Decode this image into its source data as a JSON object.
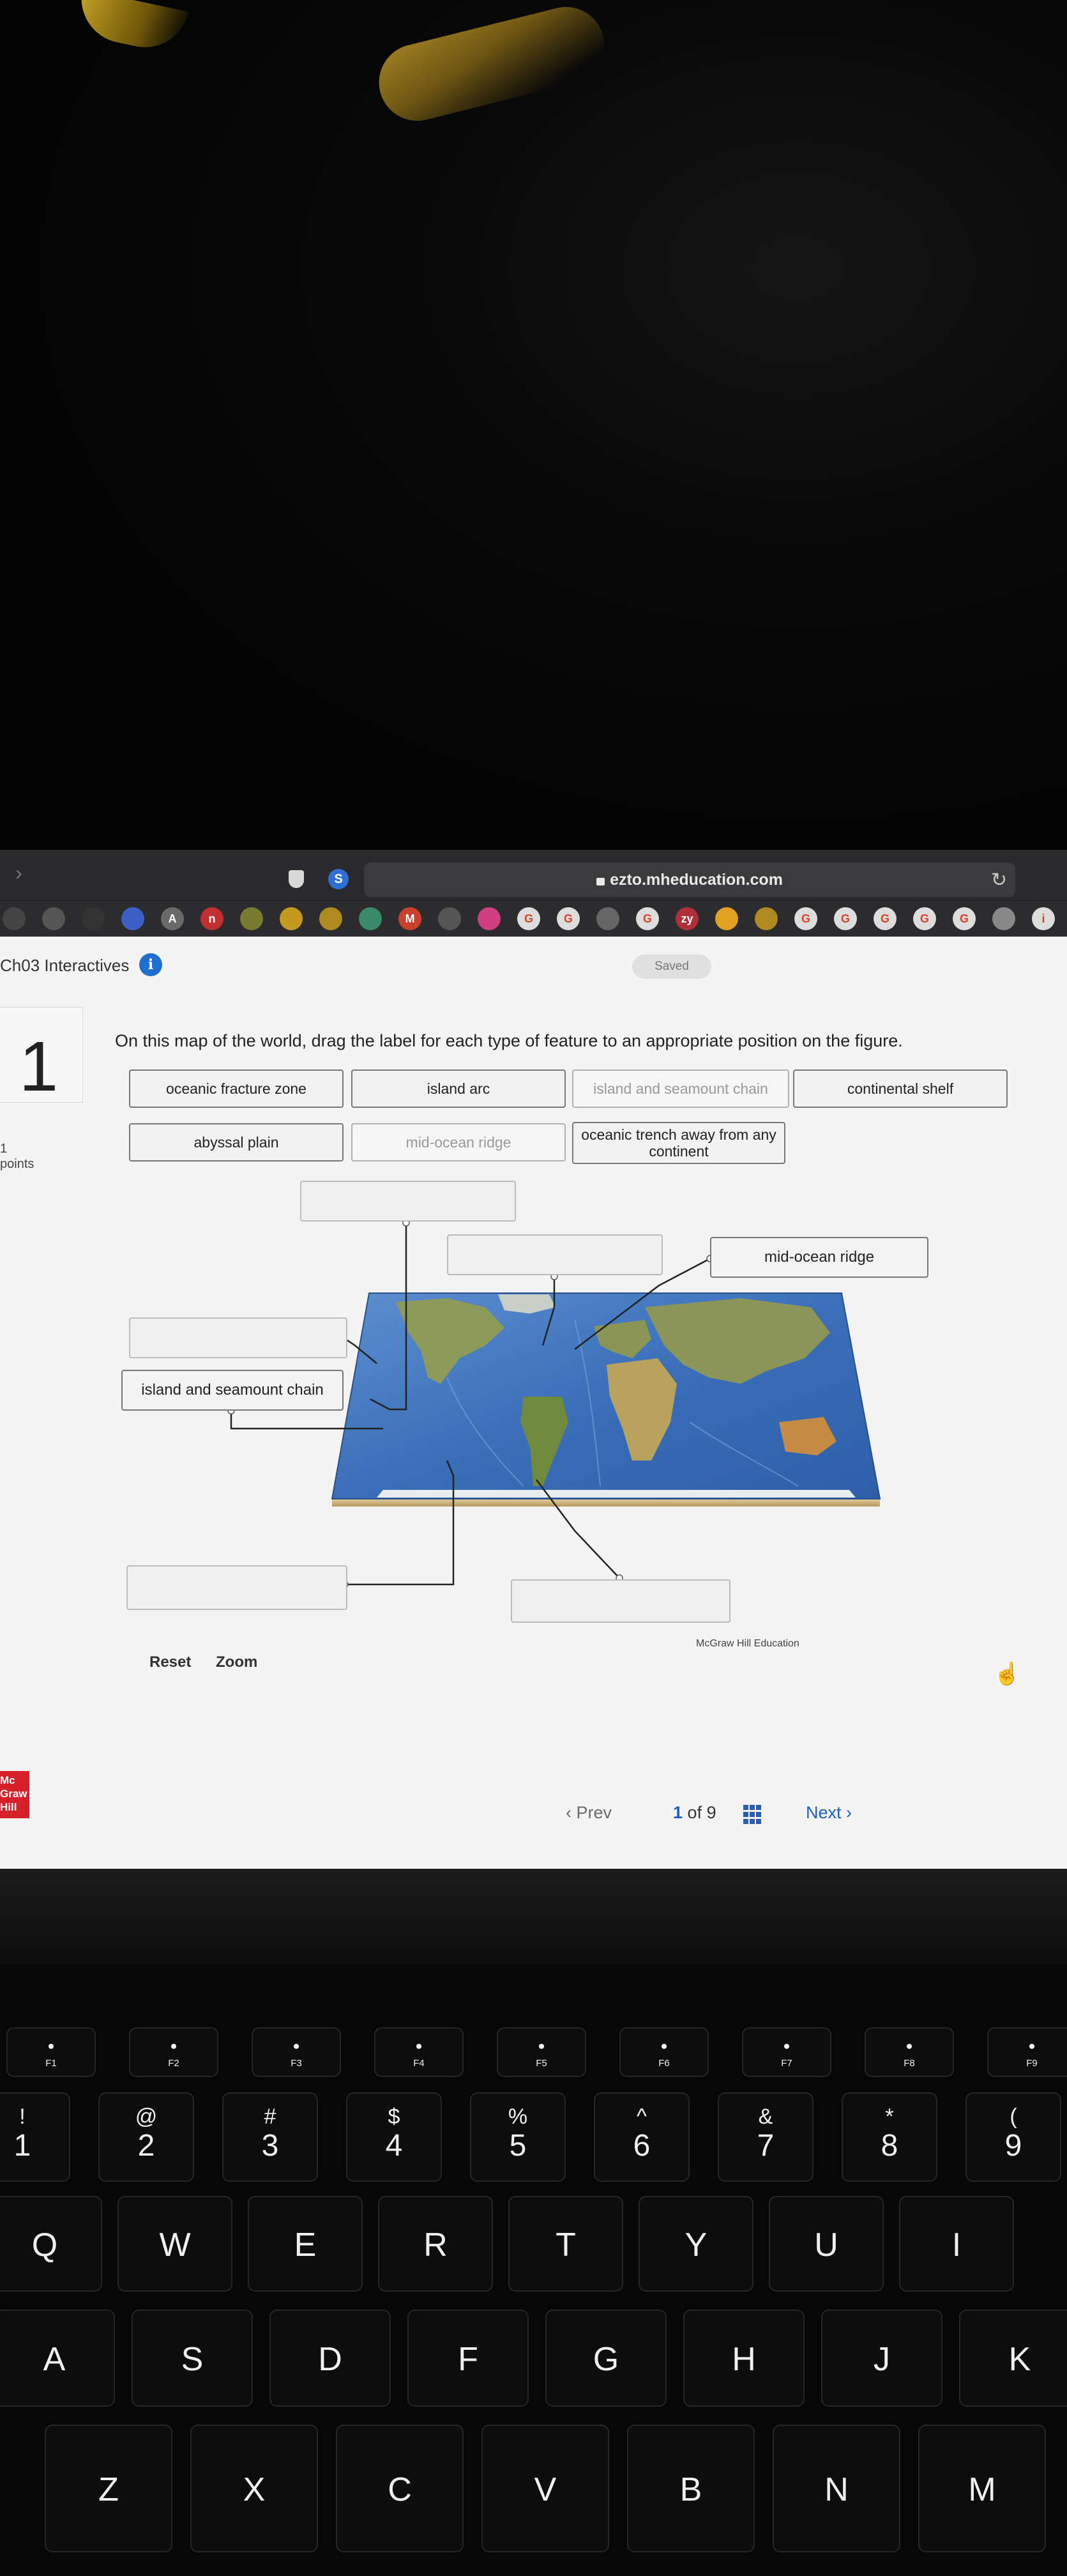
{
  "browser": {
    "url": "ezto.mheducation.com",
    "bookmark_icons": [
      "dji",
      "chatgpt",
      "dji",
      "zoom",
      "A",
      "n",
      "gear",
      "circle-g",
      "trello",
      "bank",
      "M",
      "asu",
      "cloud",
      "G",
      "G",
      "chatgpt",
      "G",
      "zy",
      "hand",
      "trello",
      "G",
      "G",
      "G",
      "G",
      "G",
      "quill",
      "info",
      "G"
    ]
  },
  "app": {
    "title": "Ch03 Interactives",
    "saved_label": "Saved"
  },
  "question": {
    "number": "1",
    "points": "1\npoints",
    "instruction": "On this map of the world, drag the label for each type of feature to an appropriate position on the figure."
  },
  "labels": [
    {
      "text": "oceanic fracture zone",
      "used": false
    },
    {
      "text": "island arc",
      "used": false
    },
    {
      "text": "island and seamount chain",
      "used": true
    },
    {
      "text": "continental shelf",
      "used": false
    },
    {
      "text": "abyssal plain",
      "used": false
    },
    {
      "text": "mid-ocean ridge",
      "used": true
    },
    {
      "text": "oceanic trench away from any continent",
      "used": false
    }
  ],
  "drop_targets": {
    "top_center": "",
    "upper_middle": "",
    "upper_right": "mid-ocean ridge",
    "left_upper": "",
    "left_middle": "island and seamount chain",
    "left_lower": "",
    "bottom_center": ""
  },
  "figure_credit": "McGraw Hill Education",
  "controls": {
    "reset": "Reset",
    "zoom": "Zoom"
  },
  "pagination": {
    "prev": "Prev",
    "current": "1",
    "of_label": "of 9",
    "next": "Next"
  },
  "brand_logo": "Mc\nGraw\nHill",
  "keyboard": {
    "function_row": [
      "F1",
      "F2",
      "F3",
      "F4",
      "F5",
      "F6",
      "F7",
      "F8",
      "F9"
    ],
    "number_row": [
      {
        "top": "!",
        "bottom": "1"
      },
      {
        "top": "@",
        "bottom": "2"
      },
      {
        "top": "#",
        "bottom": "3"
      },
      {
        "top": "$",
        "bottom": "4"
      },
      {
        "top": "%",
        "bottom": "5"
      },
      {
        "top": "^",
        "bottom": "6"
      },
      {
        "top": "&",
        "bottom": "7"
      },
      {
        "top": "*",
        "bottom": "8"
      },
      {
        "top": "(",
        "bottom": "9"
      }
    ],
    "row_q": [
      "Q",
      "W",
      "E",
      "R",
      "T",
      "Y",
      "U",
      "I"
    ],
    "row_a": [
      "A",
      "S",
      "D",
      "F",
      "G",
      "H",
      "J",
      "K"
    ],
    "row_z": [
      "Z",
      "X",
      "C",
      "V",
      "B",
      "N",
      "M"
    ]
  }
}
